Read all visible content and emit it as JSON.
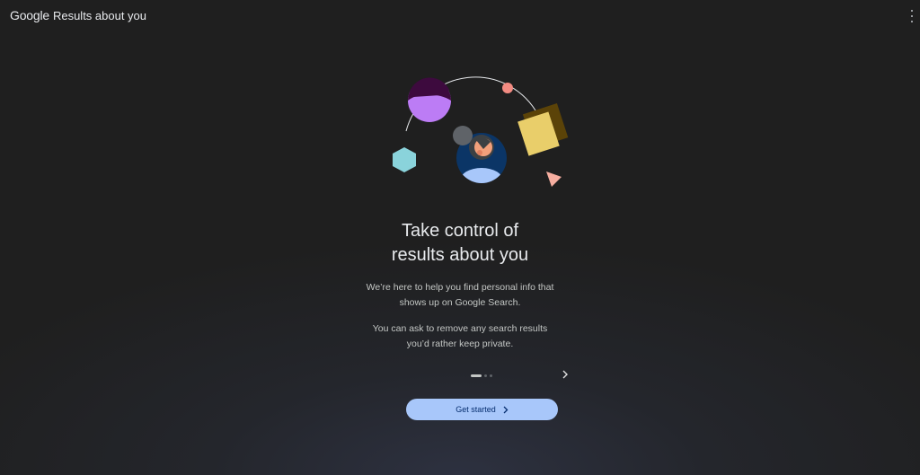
{
  "header": {
    "brand_google": "Google",
    "brand_product": "Results about you",
    "menu_icon": "more-vert-icon"
  },
  "hero": {
    "illustration": "person-with-floating-shapes",
    "colors": {
      "purple": "#bc7cf5",
      "dark_purple": "#3d0a3e",
      "coral": "#f28b82",
      "yellow": "#e9ce6a",
      "brown": "#5b4308",
      "teal": "#8ad3db",
      "peach": "#f6aea0",
      "light_blue": "#a8c7fa",
      "navy": "#0b3566"
    }
  },
  "main": {
    "title_line1": "Take control of",
    "title_line2": "results about you",
    "para1_line1": "We’re here to help you find personal info that",
    "para1_line2": "shows up on Google Search.",
    "para2_line1": "You can ask to remove any search results",
    "para2_line2": "you’d rather keep private."
  },
  "pager": {
    "pages": 3,
    "current": 1,
    "next_icon": "chevron-right-icon"
  },
  "cta": {
    "label": "Get started",
    "icon": "chevron-right-icon",
    "color": "#a8c7fa"
  }
}
